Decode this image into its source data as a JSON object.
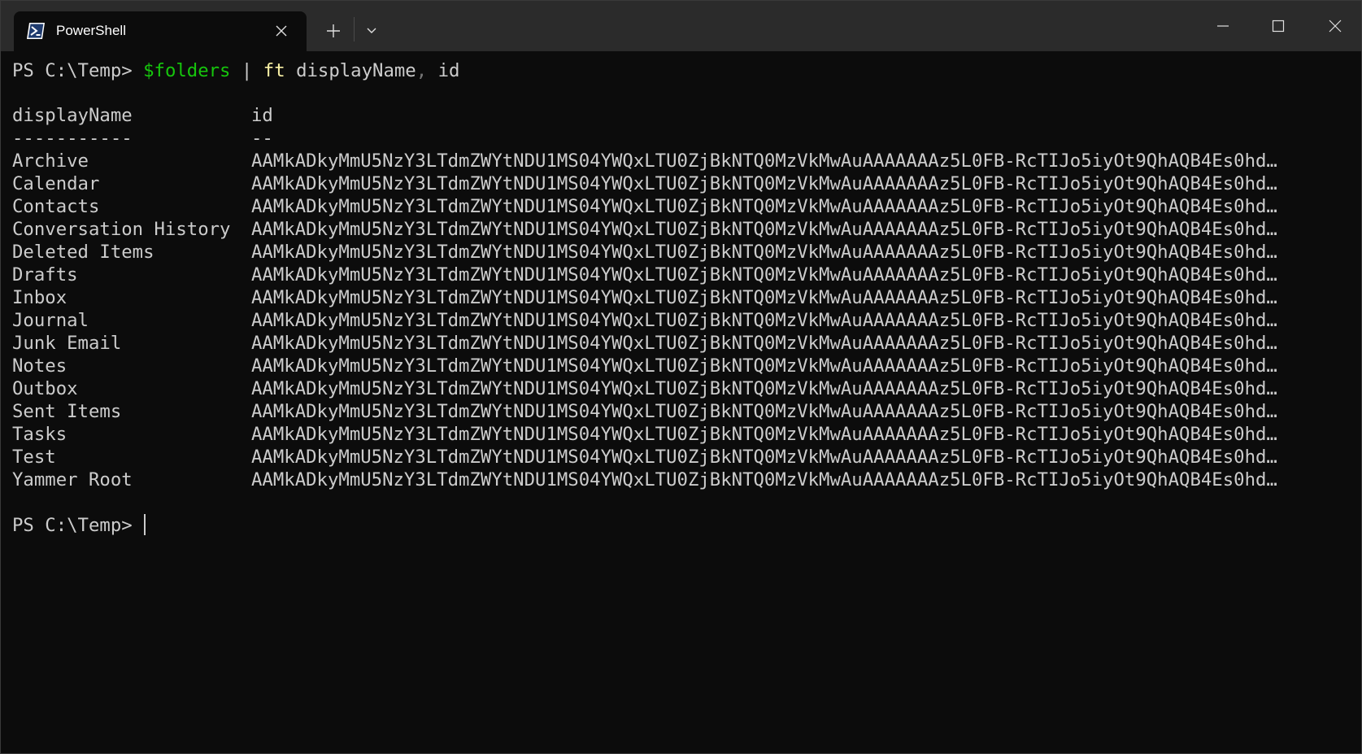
{
  "tab": {
    "title": "PowerShell",
    "icon": "powershell-icon"
  },
  "titlebar": {
    "new_tab_icon": "plus-icon",
    "dropdown_icon": "chevron-down-icon",
    "minimize_icon": "minimize-icon",
    "maximize_icon": "maximize-icon",
    "close_icon": "close-icon"
  },
  "colors": {
    "background": "#0c0c0c",
    "titlebar": "#2b2b2b",
    "text": "#cccccc",
    "green": "#16c60c",
    "yellow": "#f9f1a5",
    "separator": "#767676"
  },
  "command": {
    "prompt": "PS C:\\Temp> ",
    "variable": "$folders",
    "pipe": " | ",
    "cmdlet": "ft",
    "arg1": " displayName",
    "comma": ",",
    "arg2": " id"
  },
  "table": {
    "headers": [
      "displayName",
      "id"
    ],
    "underlines": [
      "-----------",
      "--"
    ],
    "rows": [
      {
        "name": "Archive",
        "id": "AAMkADkyMmU5NzY3LTdmZWYtNDU1MS04YWQxLTU0ZjBkNTQ0MzVkMwAuAAAAAAAz5L0FB-RcTIJo5iyOt9QhAQB4Es0hd…"
      },
      {
        "name": "Calendar",
        "id": "AAMkADkyMmU5NzY3LTdmZWYtNDU1MS04YWQxLTU0ZjBkNTQ0MzVkMwAuAAAAAAAz5L0FB-RcTIJo5iyOt9QhAQB4Es0hd…"
      },
      {
        "name": "Contacts",
        "id": "AAMkADkyMmU5NzY3LTdmZWYtNDU1MS04YWQxLTU0ZjBkNTQ0MzVkMwAuAAAAAAAz5L0FB-RcTIJo5iyOt9QhAQB4Es0hd…"
      },
      {
        "name": "Conversation History",
        "id": "AAMkADkyMmU5NzY3LTdmZWYtNDU1MS04YWQxLTU0ZjBkNTQ0MzVkMwAuAAAAAAAz5L0FB-RcTIJo5iyOt9QhAQB4Es0hd…"
      },
      {
        "name": "Deleted Items",
        "id": "AAMkADkyMmU5NzY3LTdmZWYtNDU1MS04YWQxLTU0ZjBkNTQ0MzVkMwAuAAAAAAAz5L0FB-RcTIJo5iyOt9QhAQB4Es0hd…"
      },
      {
        "name": "Drafts",
        "id": "AAMkADkyMmU5NzY3LTdmZWYtNDU1MS04YWQxLTU0ZjBkNTQ0MzVkMwAuAAAAAAAz5L0FB-RcTIJo5iyOt9QhAQB4Es0hd…"
      },
      {
        "name": "Inbox",
        "id": "AAMkADkyMmU5NzY3LTdmZWYtNDU1MS04YWQxLTU0ZjBkNTQ0MzVkMwAuAAAAAAAz5L0FB-RcTIJo5iyOt9QhAQB4Es0hd…"
      },
      {
        "name": "Journal",
        "id": "AAMkADkyMmU5NzY3LTdmZWYtNDU1MS04YWQxLTU0ZjBkNTQ0MzVkMwAuAAAAAAAz5L0FB-RcTIJo5iyOt9QhAQB4Es0hd…"
      },
      {
        "name": "Junk Email",
        "id": "AAMkADkyMmU5NzY3LTdmZWYtNDU1MS04YWQxLTU0ZjBkNTQ0MzVkMwAuAAAAAAAz5L0FB-RcTIJo5iyOt9QhAQB4Es0hd…"
      },
      {
        "name": "Notes",
        "id": "AAMkADkyMmU5NzY3LTdmZWYtNDU1MS04YWQxLTU0ZjBkNTQ0MzVkMwAuAAAAAAAz5L0FB-RcTIJo5iyOt9QhAQB4Es0hd…"
      },
      {
        "name": "Outbox",
        "id": "AAMkADkyMmU5NzY3LTdmZWYtNDU1MS04YWQxLTU0ZjBkNTQ0MzVkMwAuAAAAAAAz5L0FB-RcTIJo5iyOt9QhAQB4Es0hd…"
      },
      {
        "name": "Sent Items",
        "id": "AAMkADkyMmU5NzY3LTdmZWYtNDU1MS04YWQxLTU0ZjBkNTQ0MzVkMwAuAAAAAAAz5L0FB-RcTIJo5iyOt9QhAQB4Es0hd…"
      },
      {
        "name": "Tasks",
        "id": "AAMkADkyMmU5NzY3LTdmZWYtNDU1MS04YWQxLTU0ZjBkNTQ0MzVkMwAuAAAAAAAz5L0FB-RcTIJo5iyOt9QhAQB4Es0hd…"
      },
      {
        "name": "Test",
        "id": "AAMkADkyMmU5NzY3LTdmZWYtNDU1MS04YWQxLTU0ZjBkNTQ0MzVkMwAuAAAAAAAz5L0FB-RcTIJo5iyOt9QhAQB4Es0hd…"
      },
      {
        "name": "Yammer Root",
        "id": "AAMkADkyMmU5NzY3LTdmZWYtNDU1MS04YWQxLTU0ZjBkNTQ0MzVkMwAuAAAAAAAz5L0FB-RcTIJo5iyOt9QhAQB4Es0hd…"
      }
    ]
  },
  "final_prompt": "PS C:\\Temp> "
}
